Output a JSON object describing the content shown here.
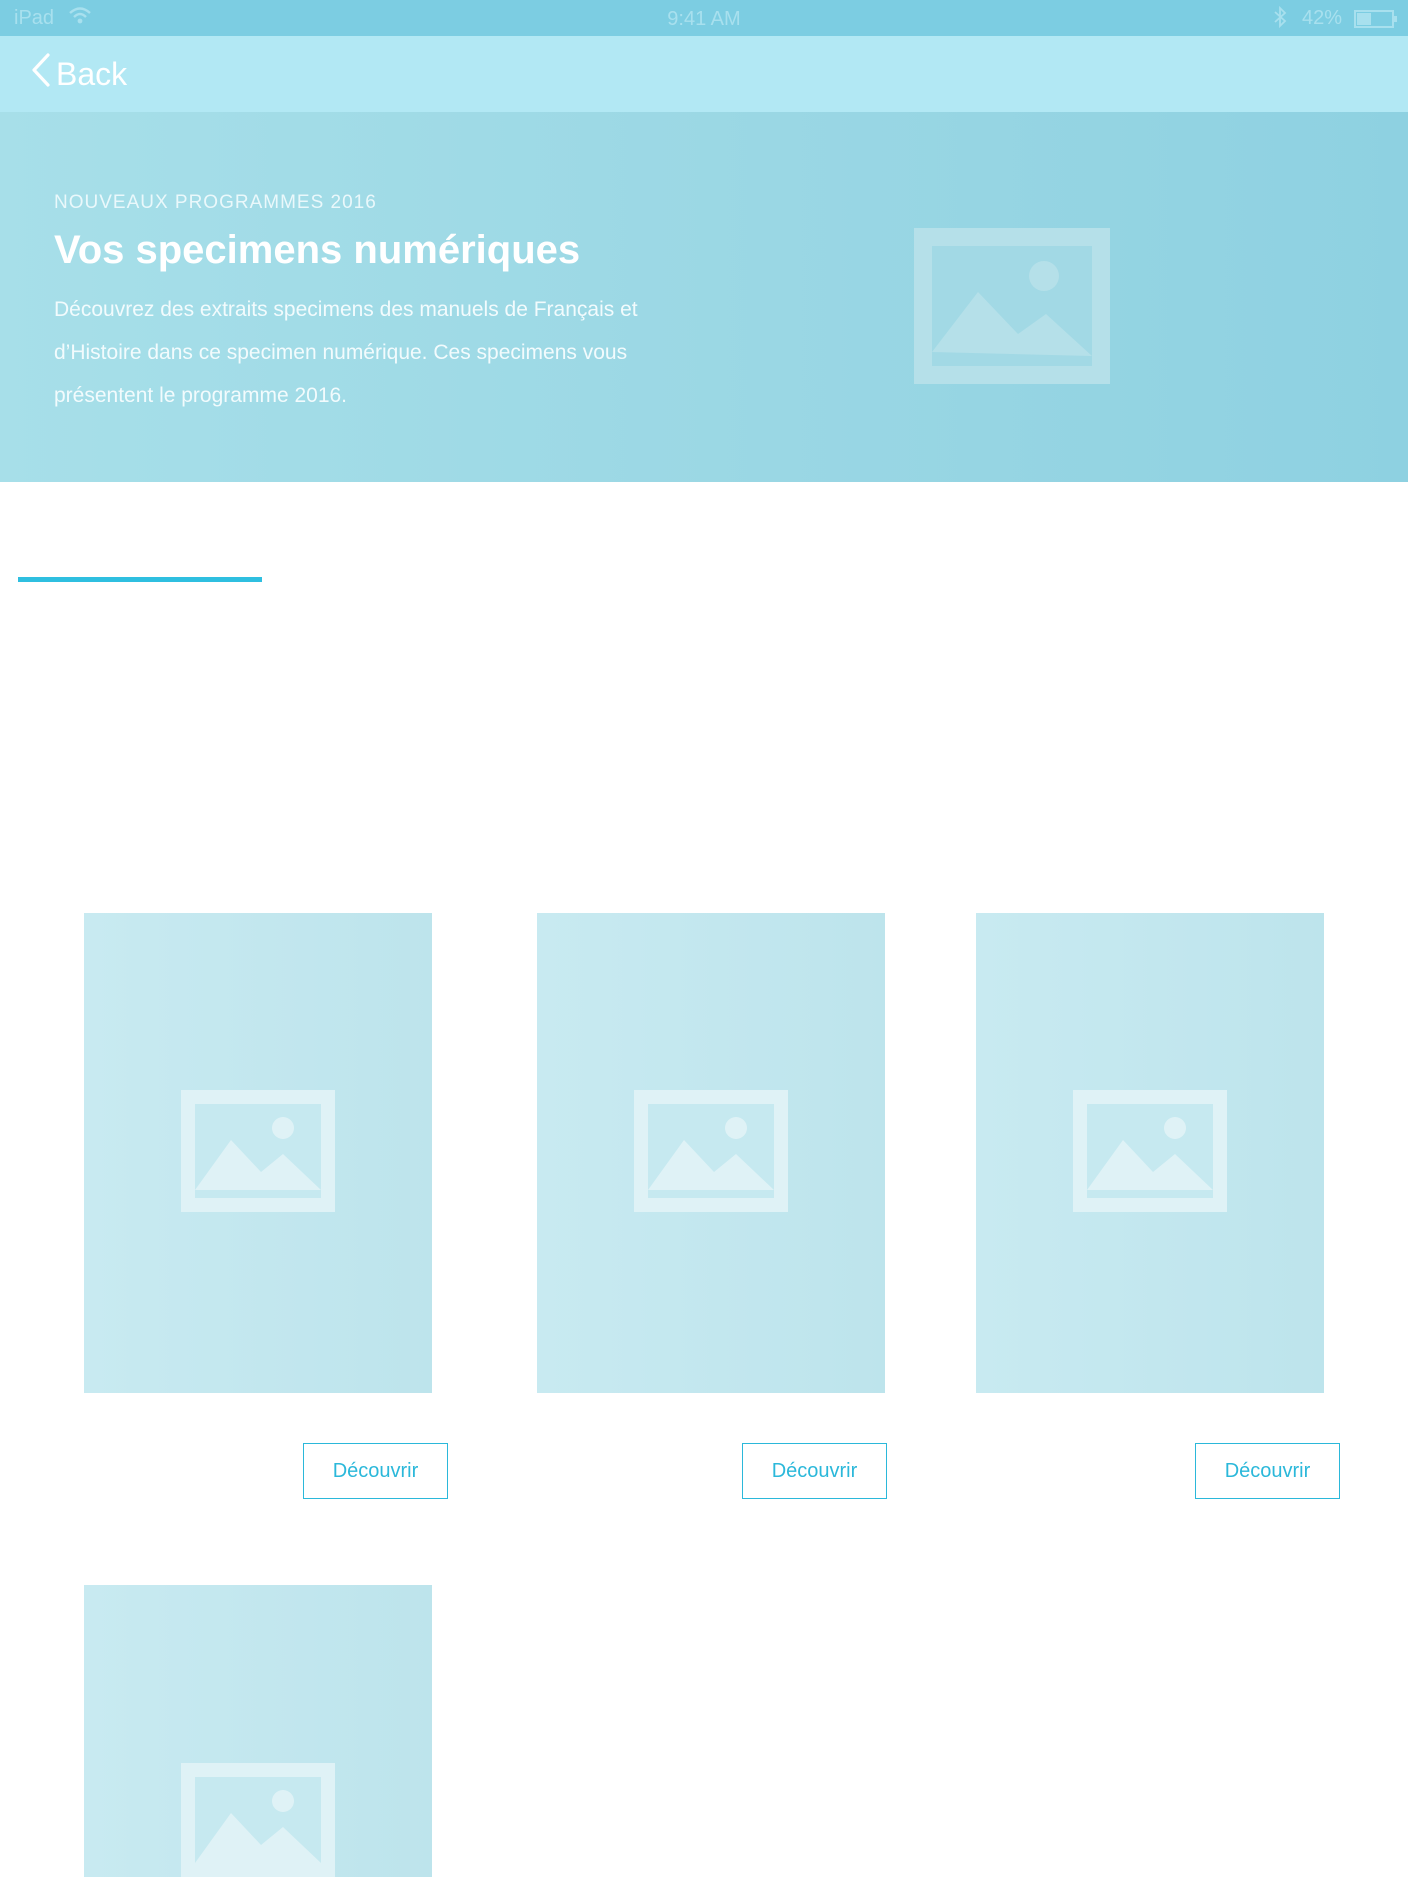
{
  "status_bar": {
    "device": "iPad",
    "time": "9:41 AM",
    "battery": "42%",
    "battery_level": 0.42
  },
  "nav": {
    "back_label": "Back"
  },
  "hero": {
    "kicker": "NOUVEAUX PROGRAMMES 2016",
    "title": "Vos specimens numériques",
    "description": "Découvrez des extraits specimens des manuels de Français et d’Histoire dans ce specimen numérique. Ces specimens vous présentent le programme 2016.",
    "image_icon": "image-placeholder-icon"
  },
  "cards": [
    {
      "button_label": "Découvrir",
      "image_icon": "image-placeholder-icon"
    },
    {
      "button_label": "Découvrir",
      "image_icon": "image-placeholder-icon"
    },
    {
      "button_label": "Découvrir",
      "image_icon": "image-placeholder-icon"
    },
    {
      "image_icon": "image-placeholder-icon"
    }
  ],
  "colors": {
    "status_bar": "#7ccde2",
    "nav_bar": "#b2e8f4",
    "hero": "#9ad7e4",
    "accent": "#2bb8da",
    "card": "#c4e8ef"
  }
}
